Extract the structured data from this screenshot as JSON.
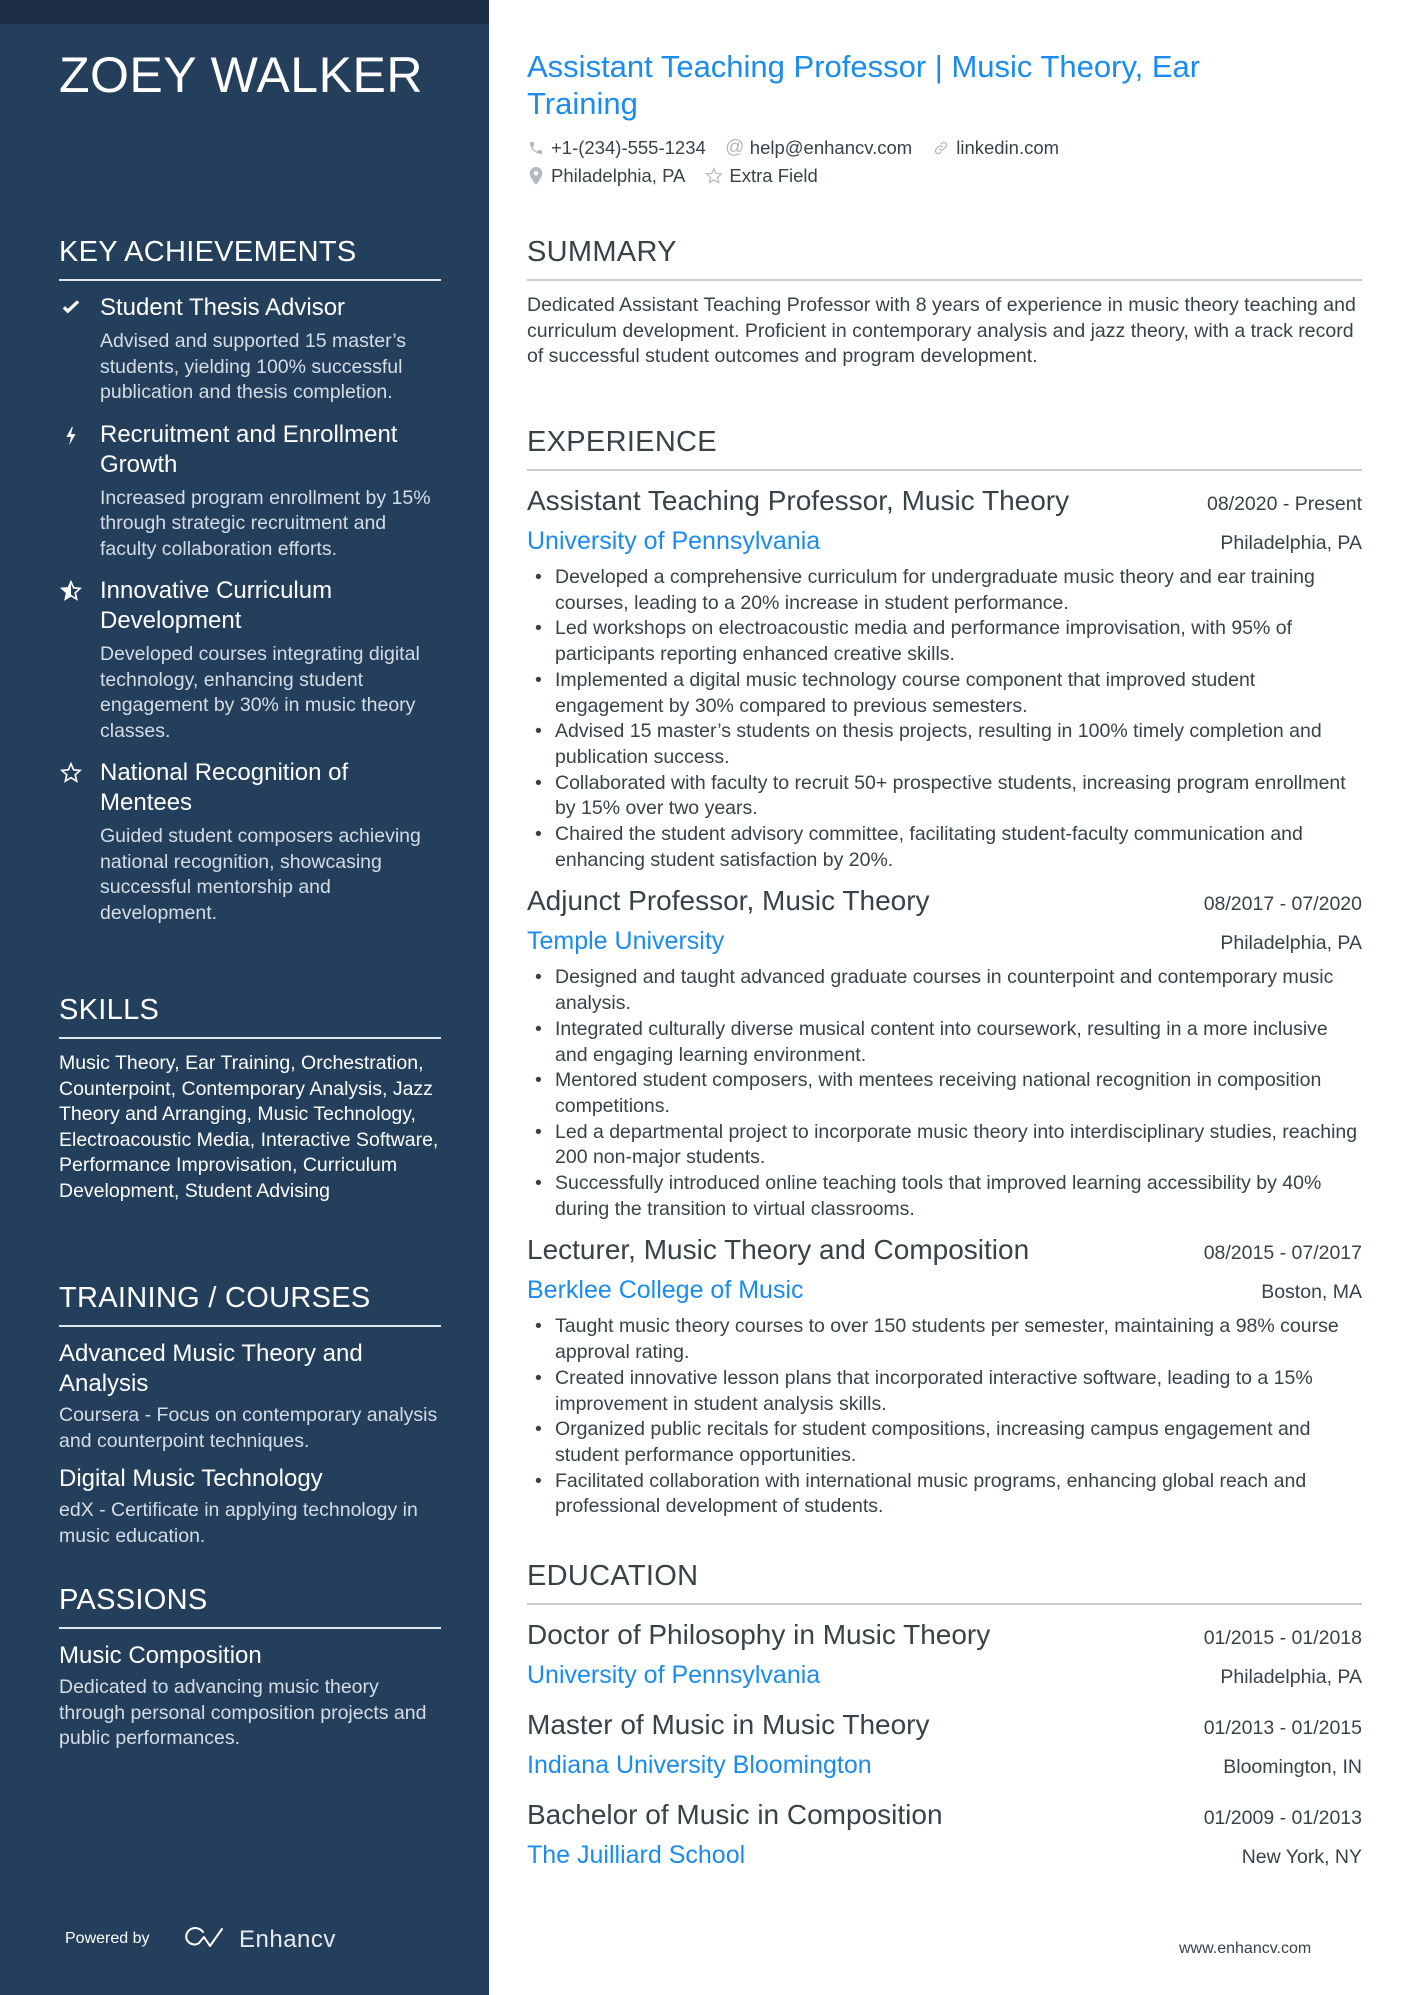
{
  "sidebar": {
    "name": "ZOEY WALKER",
    "key_achievements": {
      "heading": "KEY ACHIEVEMENTS",
      "items": [
        {
          "icon": "check-icon",
          "title": "Student Thesis Advisor",
          "description": "Advised and supported 15 master’s students, yielding 100% successful publication and thesis completion."
        },
        {
          "icon": "lightning-icon",
          "title": "Recruitment and Enrollment Growth",
          "description": "Increased program enrollment by 15% through strategic recruitment and faculty collaboration efforts."
        },
        {
          "icon": "star-half-icon",
          "title": "Innovative Curriculum Development",
          "description": "Developed courses integrating digital technology, enhancing student engagement by 30% in music theory classes."
        },
        {
          "icon": "star-outline-icon",
          "title": "National Recognition of Mentees",
          "description": "Guided student composers achieving national recognition, showcasing successful mentorship and development."
        }
      ]
    },
    "skills": {
      "heading": "SKILLS",
      "text": "Music Theory, Ear Training, Orchestration, Counterpoint, Contemporary Analysis, Jazz Theory and Arranging, Music Technology, Electroacoustic Media, Interactive Software, Performance Improvisation, Curriculum Development, Student Advising"
    },
    "training": {
      "heading": "TRAINING / COURSES",
      "items": [
        {
          "title": "Advanced Music Theory and Analysis",
          "description": "Coursera - Focus on contemporary analysis and counterpoint techniques."
        },
        {
          "title": "Digital Music Technology",
          "description": "edX - Certificate in applying technology in music education."
        }
      ]
    },
    "passions": {
      "heading": "PASSIONS",
      "items": [
        {
          "title": "Music Composition",
          "description": "Dedicated to advancing music theory through personal composition projects and public performances."
        }
      ]
    },
    "footer": {
      "powered_by": "Powered by",
      "brand": "Enhancv"
    }
  },
  "header": {
    "title": "Assistant Teaching Professor | Music Theory, Ear Training",
    "contacts": {
      "phone": "+1-(234)-555-1234",
      "email": "help@enhancv.com",
      "link": "linkedin.com",
      "location": "Philadelphia, PA",
      "extra": "Extra Field"
    }
  },
  "summary": {
    "heading": "SUMMARY",
    "text": "Dedicated Assistant Teaching Professor with 8 years of experience in music theory teaching and curriculum development. Proficient in contemporary analysis and jazz theory, with a track record of successful student outcomes and program development."
  },
  "experience": {
    "heading": "EXPERIENCE",
    "jobs": [
      {
        "role": "Assistant Teaching Professor, Music Theory",
        "dates": "08/2020 - Present",
        "org": "University of Pennsylvania",
        "location": "Philadelphia, PA",
        "bullets": [
          "Developed a comprehensive curriculum for undergraduate music theory and ear training courses, leading to a 20% increase in student performance.",
          "Led workshops on electroacoustic media and performance improvisation, with 95% of participants reporting enhanced creative skills.",
          "Implemented a digital music technology course component that improved student engagement by 30% compared to previous semesters.",
          "Advised 15 master’s students on thesis projects, resulting in 100% timely completion and publication success.",
          "Collaborated with faculty to recruit 50+ prospective students, increasing program enrollment by 15% over two years.",
          "Chaired the student advisory committee, facilitating student-faculty communication and enhancing student satisfaction by 20%."
        ]
      },
      {
        "role": "Adjunct Professor, Music Theory",
        "dates": "08/2017 - 07/2020",
        "org": "Temple University",
        "location": "Philadelphia, PA",
        "bullets": [
          "Designed and taught advanced graduate courses in counterpoint and contemporary music analysis.",
          "Integrated culturally diverse musical content into coursework, resulting in a more inclusive and engaging learning environment.",
          "Mentored student composers, with mentees receiving national recognition in composition competitions.",
          "Led a departmental project to incorporate music theory into interdisciplinary studies, reaching 200 non-major students.",
          "Successfully introduced online teaching tools that improved learning accessibility by 40% during the transition to virtual classrooms."
        ]
      },
      {
        "role": "Lecturer, Music Theory and Composition",
        "dates": "08/2015 - 07/2017",
        "org": "Berklee College of Music",
        "location": "Boston, MA",
        "bullets": [
          "Taught music theory courses to over 150 students per semester, maintaining a 98% course approval rating.",
          "Created innovative lesson plans that incorporated interactive software, leading to a 15% improvement in student analysis skills.",
          "Organized public recitals for student compositions, increasing campus engagement and student performance opportunities.",
          "Facilitated collaboration with international music programs, enhancing global reach and professional development of students."
        ]
      }
    ]
  },
  "education": {
    "heading": "EDUCATION",
    "items": [
      {
        "degree": "Doctor of Philosophy in Music Theory",
        "dates": "01/2015 - 01/2018",
        "school": "University of Pennsylvania",
        "location": "Philadelphia, PA"
      },
      {
        "degree": "Master of Music in Music Theory",
        "dates": "01/2013 - 01/2015",
        "school": "Indiana University Bloomington",
        "location": "Bloomington, IN"
      },
      {
        "degree": "Bachelor of Music in Composition",
        "dates": "01/2009 - 01/2013",
        "school": "The Juilliard School",
        "location": "New York, NY"
      }
    ]
  },
  "footer": {
    "url": "www.enhancv.com"
  },
  "colors": {
    "sidebar": "#243f5c",
    "sidebar_strip": "#1c2e44",
    "accent": "#1a8cf0",
    "text": "#384347"
  }
}
